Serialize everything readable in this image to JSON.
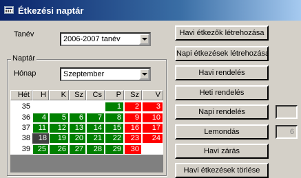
{
  "window": {
    "title": "Étkezési naptár"
  },
  "tanev": {
    "label": "Tanév",
    "value": "2006-2007 tanév"
  },
  "naptar": {
    "group_label": "Naptár",
    "honap_label": "Hónap",
    "honap_value": "Szeptember"
  },
  "calendar": {
    "headers": [
      "Hét",
      "H",
      "K",
      "Sz",
      "Cs",
      "P",
      "Sz",
      "V"
    ],
    "colors": {
      "green": "#008000",
      "red": "#ff0000",
      "dark": "#404040"
    },
    "rows": [
      {
        "week": "35",
        "days": [
          {
            "t": "",
            "c": "empty"
          },
          {
            "t": "",
            "c": "empty"
          },
          {
            "t": "",
            "c": "empty"
          },
          {
            "t": "",
            "c": "empty"
          },
          {
            "t": "1",
            "c": "green"
          },
          {
            "t": "2",
            "c": "red"
          },
          {
            "t": "3",
            "c": "red"
          }
        ]
      },
      {
        "week": "36",
        "days": [
          {
            "t": "4",
            "c": "green"
          },
          {
            "t": "5",
            "c": "green"
          },
          {
            "t": "6",
            "c": "green"
          },
          {
            "t": "7",
            "c": "green"
          },
          {
            "t": "8",
            "c": "green"
          },
          {
            "t": "9",
            "c": "red"
          },
          {
            "t": "10",
            "c": "red"
          }
        ]
      },
      {
        "week": "37",
        "days": [
          {
            "t": "11",
            "c": "green"
          },
          {
            "t": "12",
            "c": "green"
          },
          {
            "t": "13",
            "c": "green"
          },
          {
            "t": "14",
            "c": "green"
          },
          {
            "t": "15",
            "c": "green"
          },
          {
            "t": "16",
            "c": "red"
          },
          {
            "t": "17",
            "c": "red"
          }
        ]
      },
      {
        "week": "38",
        "days": [
          {
            "t": "18",
            "c": "dark"
          },
          {
            "t": "19",
            "c": "green"
          },
          {
            "t": "20",
            "c": "green"
          },
          {
            "t": "21",
            "c": "green"
          },
          {
            "t": "22",
            "c": "green"
          },
          {
            "t": "23",
            "c": "red"
          },
          {
            "t": "24",
            "c": "red"
          }
        ]
      },
      {
        "week": "39",
        "days": [
          {
            "t": "25",
            "c": "green"
          },
          {
            "t": "26",
            "c": "green"
          },
          {
            "t": "27",
            "c": "green"
          },
          {
            "t": "28",
            "c": "green"
          },
          {
            "t": "29",
            "c": "green"
          },
          {
            "t": "30",
            "c": "red"
          },
          {
            "t": "",
            "c": "empty"
          }
        ]
      }
    ]
  },
  "buttons": {
    "havi_etkezok": "Havi étkezők létrehozása",
    "napi_etkezesek": "Napi étkezések létrehozása",
    "havi_rendeles": "Havi rendelés",
    "heti_rendeles": "Heti rendelés",
    "napi_rendeles": "Napi rendelés",
    "lemondas": "Lemondás",
    "havi_zaras": "Havi zárás",
    "havi_etkezesek_torlese": "Havi étkezések törlése"
  },
  "side_fields": {
    "napi_value": "",
    "lemondas_value": "6"
  },
  "icons": {
    "title_icon": "window-calendar-icon",
    "dropdown": "chevron-down-icon"
  }
}
